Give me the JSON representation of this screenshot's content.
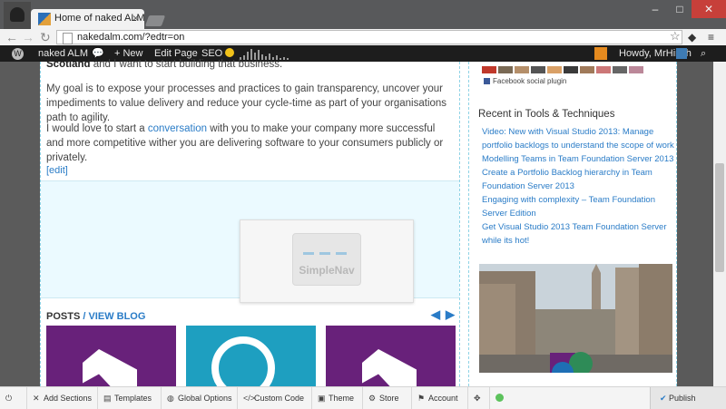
{
  "browser": {
    "tab_title": "Home of naked ALM",
    "tab_close": "×",
    "address": "nakedalm.com/?edtr=on",
    "window_controls": [
      "–",
      "□",
      "✕"
    ]
  },
  "adminbar": {
    "site_name": "naked ALM",
    "new_label": "New",
    "edit_page": "Edit Page",
    "seo_label": "SEO",
    "howdy": "Howdy, MrHinsh"
  },
  "content": {
    "partial_line_bold": "Scotland",
    "partial_line_rest": " and I want to start building that business.",
    "para1": "My goal is to expose your processes and practices to gain transparency, uncover your impediments to value delivery and reduce your cycle-time as part of your organisations path to agility.",
    "para2_pre": "I would love to start a ",
    "para2_link": "conversation",
    "para2_post": " with you to make your company more successful and more competitive wither you are delivering software to your consumers publicly or privately.",
    "edit_link": "[edit]",
    "simplenav_label": "SimpleNav",
    "posts_label": "POSTS",
    "posts_sep": " / ",
    "view_blog": "VIEW BLOG",
    "prev_arrow": "◀",
    "next_arrow": "▶"
  },
  "sidebar": {
    "fb_plugin": "Facebook social plugin",
    "recent_title": "Recent in Tools & Techniques",
    "recent_items": [
      "Video: New with Visual Studio 2013: Manage portfolio backlogs to understand the scope of work",
      "Modelling Teams in Team Foundation Server 2013",
      "Create a Portfolio Backlog hierarchy in Team Foundation Server 2013",
      "Engaging with complexity – Team Foundation Server Edition",
      "Get Visual Studio 2013 Team Foundation Server while its hot!"
    ]
  },
  "builder": {
    "add_sections": "Add Sections",
    "templates": "Templates",
    "global_options": "Global Options",
    "custom_code": "Custom Code",
    "theme": "Theme",
    "store": "Store",
    "account": "Account",
    "publish": "Publish"
  },
  "colors": {
    "link": "#2a7cc7",
    "adminbar": "#1d1d1d",
    "vs_purple": "#68217a",
    "teal": "#1e9fc0",
    "publish_check": "#2a7cc7"
  }
}
